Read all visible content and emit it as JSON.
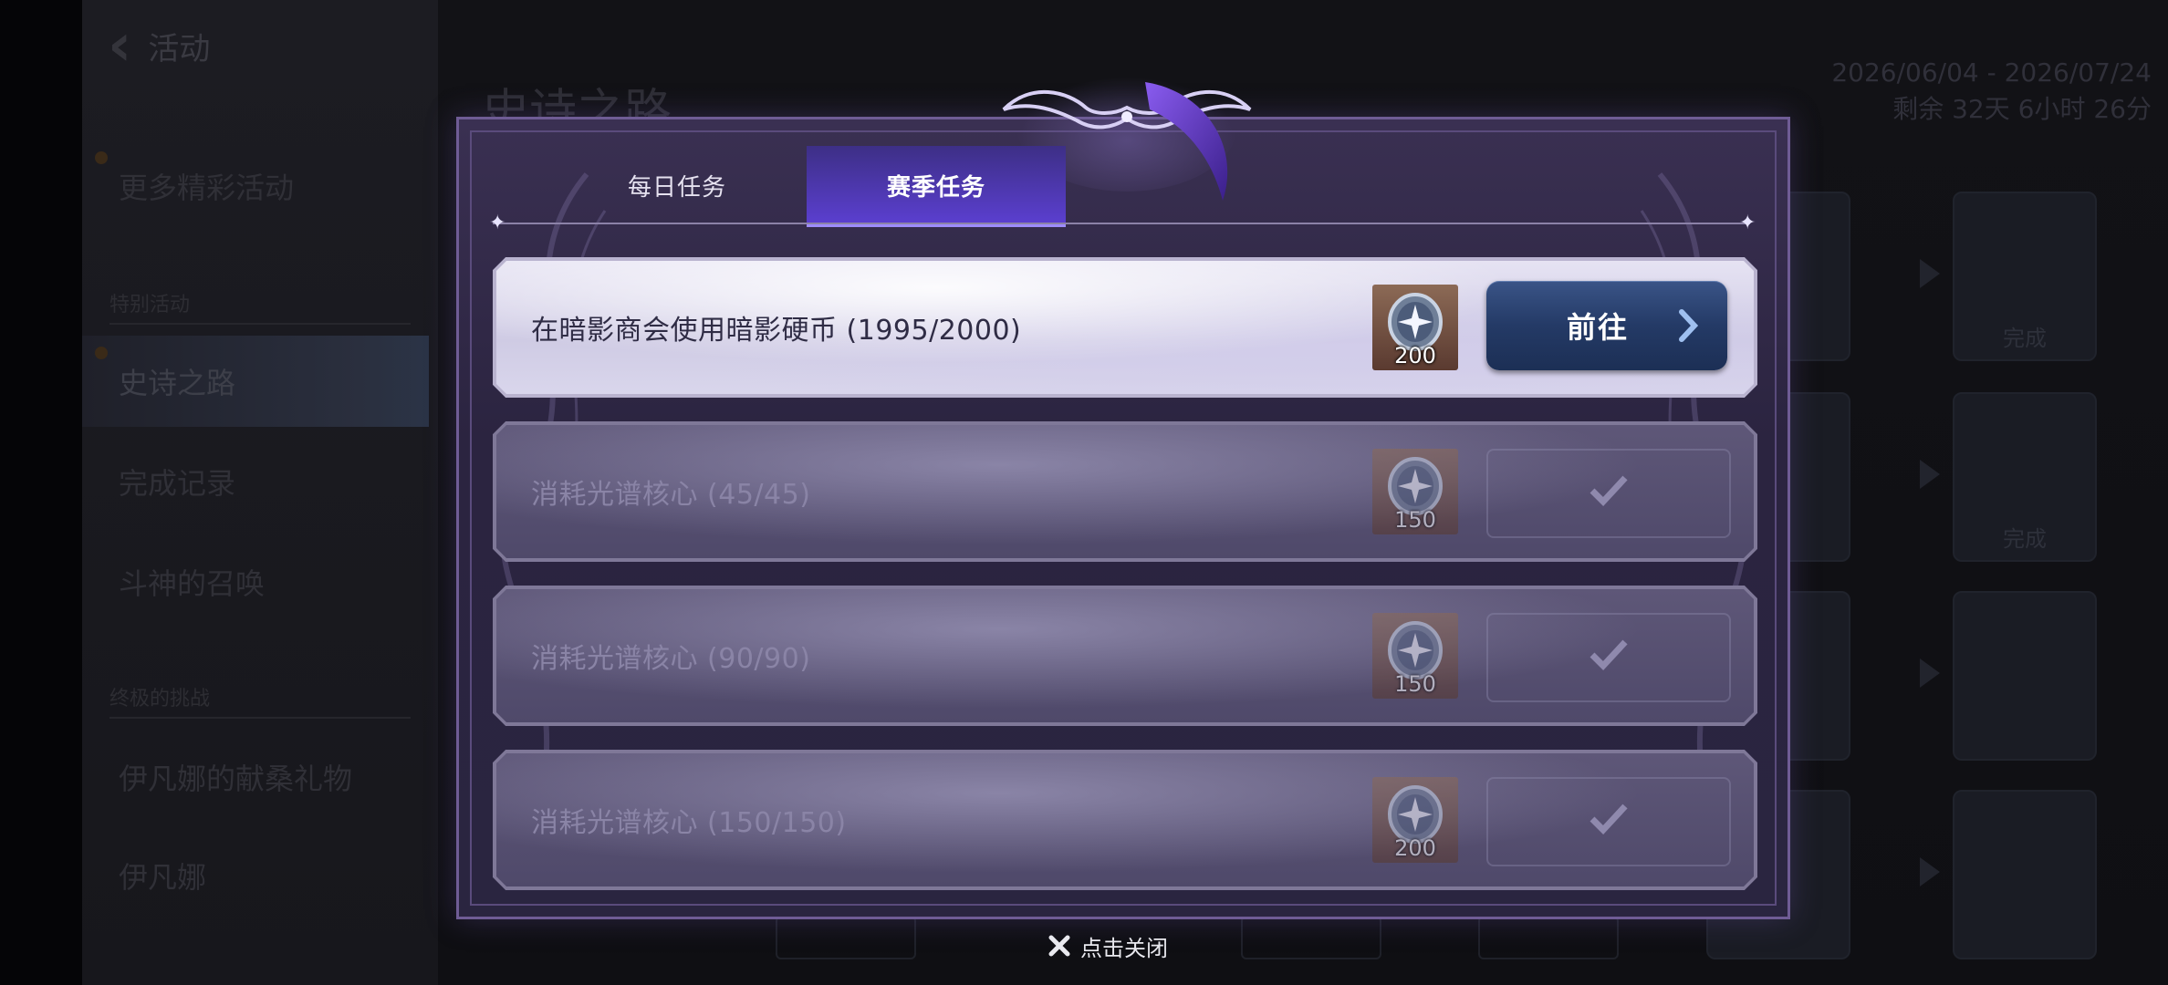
{
  "background": {
    "back_label": "活动",
    "sidebar": {
      "item_more": "更多精彩活动",
      "section_special": "特别活动",
      "item_epic": "史诗之路",
      "item_records": "完成记录",
      "item_summon": "斗神的召唤",
      "section_ultimate": "终极的挑战",
      "item_gift": "伊凡娜的献桑礼物",
      "item_ivana": "伊凡娜"
    },
    "page_title": "史诗之路",
    "date_range": "2026/06/04 - 2026/07/24",
    "remaining": "剩余 32天 6小时 26分",
    "tile_done_1": "完成",
    "tile_done_2": "完成"
  },
  "modal": {
    "tabs": [
      {
        "label": "每日任务",
        "active": false
      },
      {
        "label": "赛季任务",
        "active": true
      }
    ],
    "tasks": [
      {
        "text": "在暗影商会使用暗影硬币 (1995/2000)",
        "reward": "200",
        "state": "goto",
        "button_label": "前往"
      },
      {
        "text": "消耗光谱核心 (45/45)",
        "reward": "150",
        "state": "completed"
      },
      {
        "text": "消耗光谱核心 (90/90)",
        "reward": "150",
        "state": "completed"
      },
      {
        "text": "消耗光谱核心 (150/150)",
        "reward": "200",
        "state": "completed"
      }
    ],
    "close_label": "点击关闭"
  },
  "colors": {
    "accent_tab": "#5b3fd0",
    "button_blue": "#243a66",
    "modal_bg": "#2b2440"
  },
  "icons": [
    "back-chevron-icon",
    "coin-icon",
    "chevron-right-icon",
    "check-icon",
    "close-x-icon"
  ]
}
